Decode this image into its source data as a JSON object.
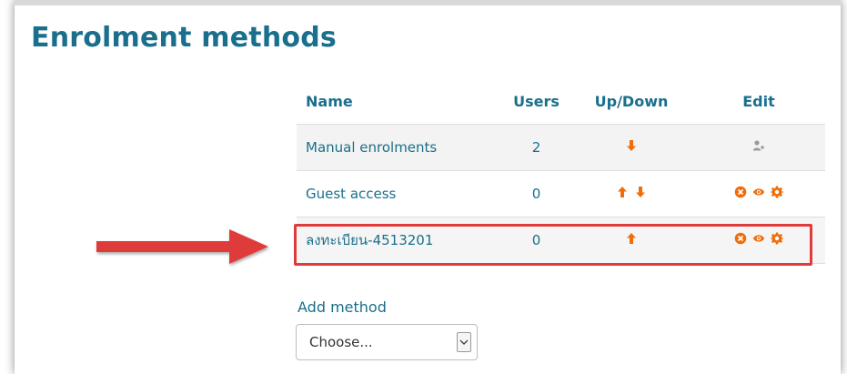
{
  "page": {
    "title": "Enrolment methods"
  },
  "table": {
    "headers": {
      "name": "Name",
      "users": "Users",
      "updown": "Up/Down",
      "edit": "Edit"
    },
    "rows": [
      {
        "name": "Manual enrolments",
        "users": "2",
        "updown": [
          "down"
        ],
        "edit": [
          "enrol-users-icon"
        ]
      },
      {
        "name": "Guest access",
        "users": "0",
        "updown": [
          "up",
          "down"
        ],
        "edit": [
          "delete-icon",
          "eye-icon",
          "gear-icon"
        ]
      },
      {
        "name": "ลงทะเบียน-4513201",
        "users": "0",
        "updown": [
          "up"
        ],
        "edit": [
          "delete-icon",
          "eye-icon",
          "gear-icon"
        ]
      }
    ]
  },
  "add_method": {
    "label": "Add method",
    "select_value": "Choose..."
  },
  "colors": {
    "accent": "#1a6f8c",
    "action_icon": "#f06d0b",
    "highlight": "#e03b3b"
  }
}
